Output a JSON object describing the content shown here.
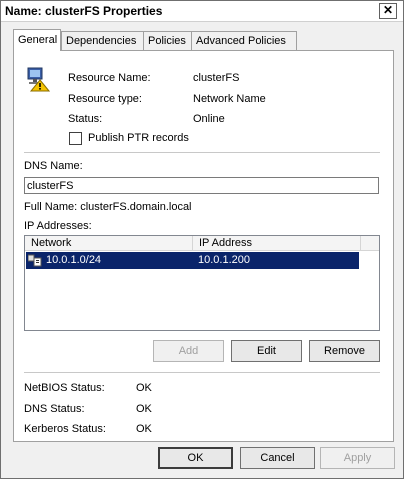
{
  "window": {
    "title": "Name: clusterFS Properties",
    "close_glyph": "✕"
  },
  "tabs": [
    "General",
    "Dependencies",
    "Policies",
    "Advanced Policies"
  ],
  "general": {
    "resource_name_label": "Resource Name:",
    "resource_name_value": "clusterFS",
    "resource_type_label": "Resource type:",
    "resource_type_value": "Network Name",
    "status_label": "Status:",
    "status_value": "Online",
    "publish_ptr_label": "Publish PTR records",
    "publish_ptr_checked": false,
    "dns_name_label": "DNS Name:",
    "dns_name_value": "clusterFS",
    "full_name": "Full Name: clusterFS.domain.local",
    "ip_addresses_label": "IP Addresses:",
    "ip_table": {
      "headers": [
        "Network",
        "IP Address"
      ],
      "rows": [
        {
          "network": "10.0.1.0/24",
          "ip": "10.0.1.200"
        }
      ]
    },
    "buttons": {
      "add": "Add",
      "edit": "Edit",
      "remove": "Remove"
    },
    "netbios_label": "NetBIOS Status:",
    "netbios_value": "OK",
    "dns_status_label": "DNS Status:",
    "dns_status_value": "OK",
    "kerberos_label": "Kerberos Status:",
    "kerberos_value": "OK"
  },
  "footer": {
    "ok": "OK",
    "cancel": "Cancel",
    "apply": "Apply"
  }
}
